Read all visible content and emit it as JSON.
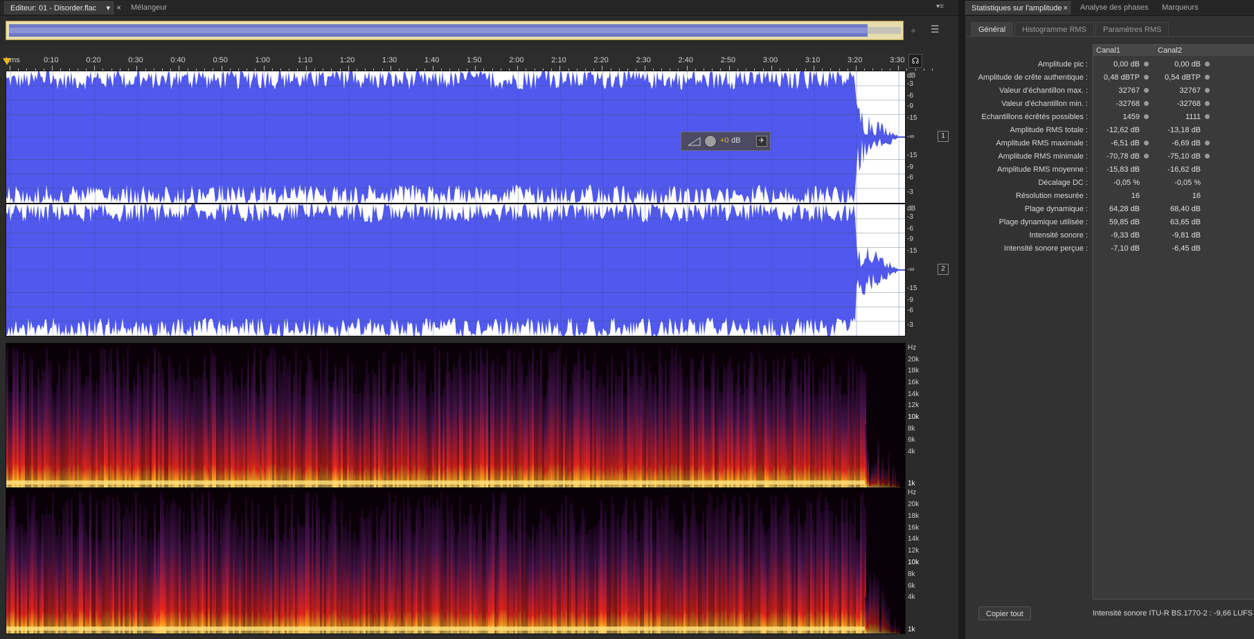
{
  "editor": {
    "tabs": [
      {
        "label": "Editeur: 01 - Disorder.flac",
        "active": true
      },
      {
        "label": "Mélangeur",
        "active": false
      }
    ],
    "close_glyph": "×",
    "dropdown_glyph": "▾",
    "menu_glyph": "▾≡"
  },
  "timeline": {
    "ticks": [
      "hms",
      "0:10",
      "0:20",
      "0:30",
      "0:40",
      "0:50",
      "1:00",
      "1:10",
      "1:20",
      "1:30",
      "1:40",
      "1:50",
      "2:00",
      "2:10",
      "2:20",
      "2:30",
      "2:40",
      "2:50",
      "3:00",
      "3:10",
      "3:20",
      "3:30"
    ]
  },
  "waveform": {
    "db_unit": "dB",
    "db_labels": [
      "-3",
      "-6",
      "-9",
      "-15",
      "-∞",
      "-15",
      "-9",
      "-6",
      "-3"
    ],
    "channels": [
      "1",
      "2"
    ],
    "hud": {
      "value": "+0",
      "unit": "dB"
    },
    "color": "#5058ee"
  },
  "spectrum": {
    "unit": "Hz",
    "freq_labels": [
      "20k",
      "18k",
      "16k",
      "14k",
      "12k",
      "10k",
      "8k",
      "6k",
      "4k",
      "1k"
    ]
  },
  "stats_panel": {
    "tabs": [
      {
        "label": "Statistiques sur l'amplitude",
        "active": true
      },
      {
        "label": "Analyse des phases",
        "active": false
      },
      {
        "label": "Marqueurs",
        "active": false
      }
    ],
    "subtabs": [
      {
        "label": "Général",
        "active": true
      },
      {
        "label": "Histogramme RMS",
        "active": false
      },
      {
        "label": "Paramètres RMS",
        "active": false
      }
    ],
    "columns": [
      "Canal1",
      "Canal2"
    ],
    "rows": [
      {
        "label": "Amplitude pic :",
        "c1": "0,00 dB",
        "c2": "0,00 dB",
        "pin": true
      },
      {
        "label": "Amplitude de crête authentique :",
        "c1": "0,48 dBTP",
        "c2": "0,54 dBTP",
        "pin": true
      },
      {
        "label": "Valeur d'échantillon max. :",
        "c1": "32767",
        "c2": "32767",
        "pin": true
      },
      {
        "label": "Valeur d'échantillon min. :",
        "c1": "-32768",
        "c2": "-32768",
        "pin": true
      },
      {
        "label": "Echantillons écrêtés possibles :",
        "c1": "1459",
        "c2": "1111",
        "pin": true
      },
      {
        "label": "Amplitude RMS totale :",
        "c1": "-12,62 dB",
        "c2": "-13,18 dB",
        "pin": false
      },
      {
        "label": "Amplitude RMS maximale :",
        "c1": "-6,51 dB",
        "c2": "-6,69 dB",
        "pin": true
      },
      {
        "label": "Amplitude RMS minimale :",
        "c1": "-70,78 dB",
        "c2": "-75,10 dB",
        "pin": true
      },
      {
        "label": "Amplitude RMS moyenne :",
        "c1": "-15,83 dB",
        "c2": "-16,62 dB",
        "pin": false
      },
      {
        "label": "Décalage DC :",
        "c1": "-0,05 %",
        "c2": "-0,05 %",
        "pin": false
      },
      {
        "label": "Résolution mesurée :",
        "c1": "16",
        "c2": "16",
        "pin": false
      },
      {
        "label": "Plage dynamique :",
        "c1": "64,28 dB",
        "c2": "68,40 dB",
        "pin": false
      },
      {
        "label": "Plage dynamique utilisée :",
        "c1": "59,85 dB",
        "c2": "63,65 dB",
        "pin": false
      },
      {
        "label": "Intensité sonore :",
        "c1": "-9,33 dB",
        "c2": "-9,81 dB",
        "pin": false
      },
      {
        "label": "Intensité sonore perçue :",
        "c1": "-7,10 dB",
        "c2": "-6,45 dB",
        "pin": false
      }
    ],
    "copy_button": "Copier tout",
    "footer": "Intensité sonore ITU-R BS.1770-2 : -9,66 LUFS"
  },
  "icons": {
    "zoom": "zoom-icon",
    "list": "list-icon",
    "headphones": "headphones-icon",
    "playhead": "playhead-marker-icon",
    "gain_knob": "gain-knob-icon",
    "pin": "pin-icon"
  },
  "colors": {
    "waveform_fill": "#5058ee",
    "background": "#2b2b2b",
    "spectrum_bg": "#0a0008",
    "spectrum_hot": "#ffdd55",
    "spectrum_mid": "#e8251c",
    "spectrum_low": "#6a1a6a"
  }
}
